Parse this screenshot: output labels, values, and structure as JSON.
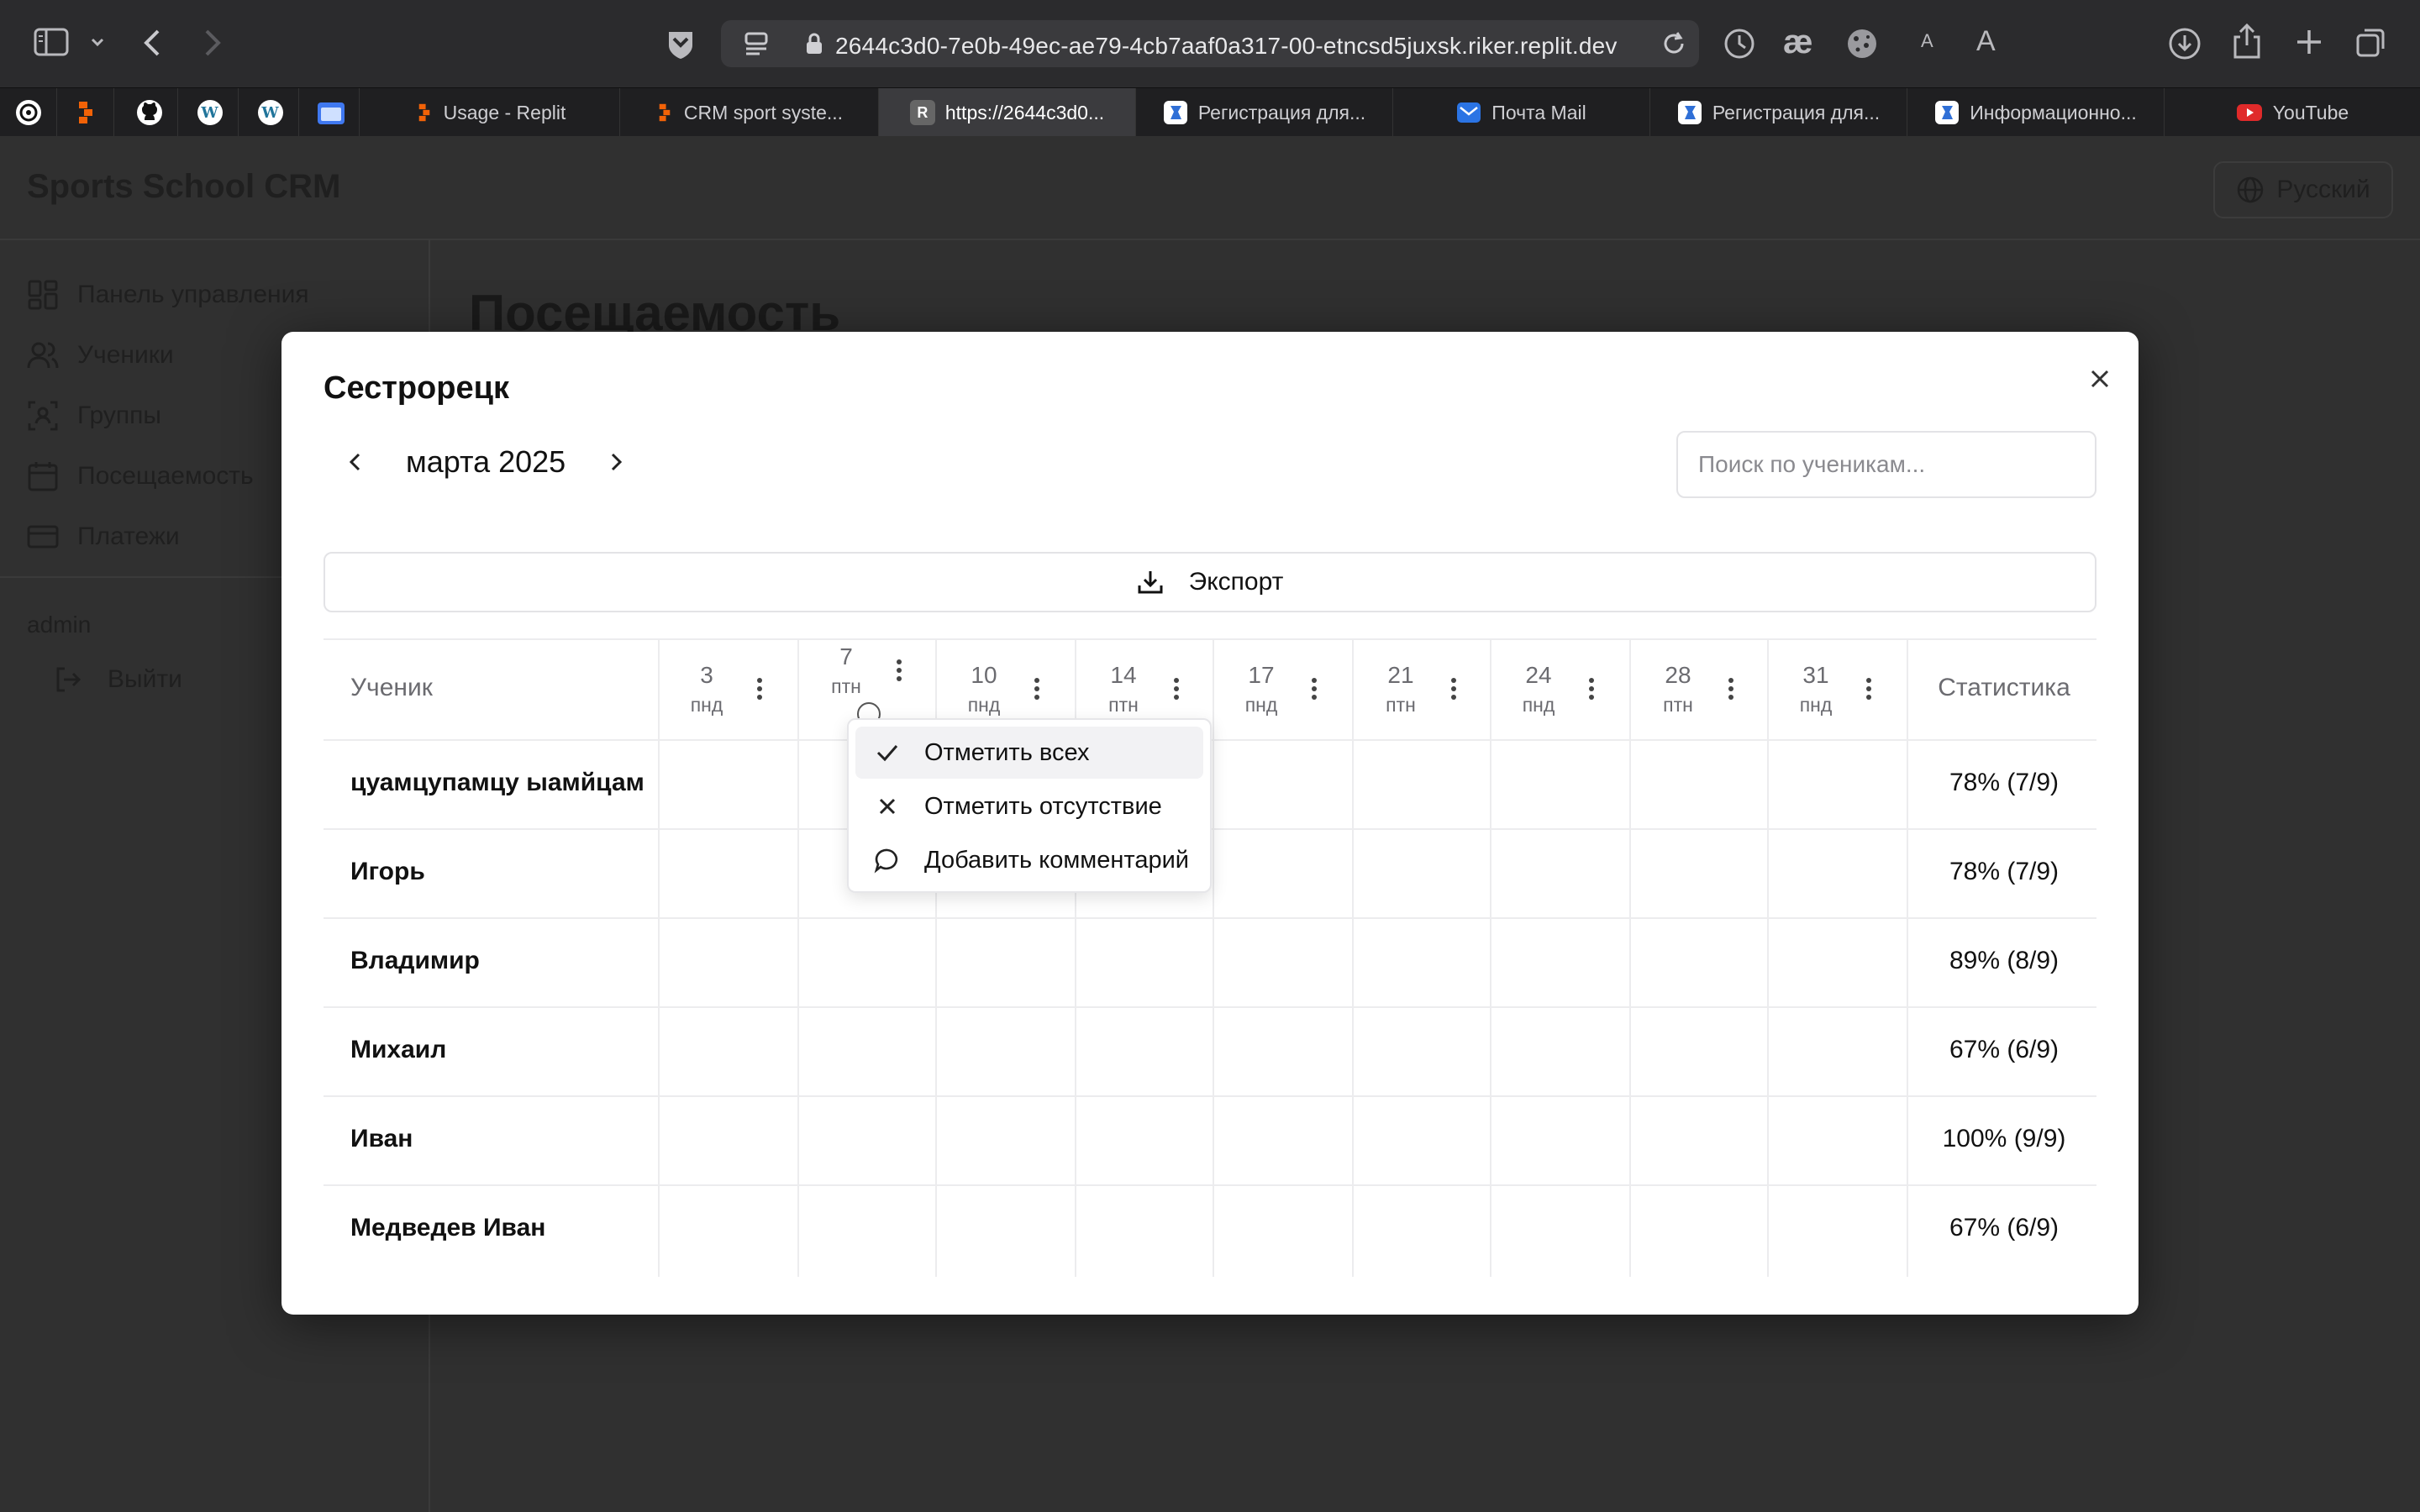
{
  "browser": {
    "url": "2644c3d0-7e0b-49ec-ae79-4cb7aaf0a317-00-etncsd5juxsk.riker.replit.dev",
    "reader_small": "A",
    "reader_large": "A",
    "tabs": [
      {
        "label": "Usage - Replit",
        "favicon": "replit"
      },
      {
        "label": "CRM sport syste...",
        "favicon": "replit"
      },
      {
        "label": "https://2644c3d0...",
        "favicon": "R",
        "active": true
      },
      {
        "label": "Регистрация для...",
        "favicon": "gosuslugi"
      },
      {
        "label": "Почта Mail",
        "favicon": "mail"
      },
      {
        "label": "Регистрация для...",
        "favicon": "gosuslugi"
      },
      {
        "label": "Информационно...",
        "favicon": "gosuslugi"
      },
      {
        "label": "YouTube",
        "favicon": "youtube"
      }
    ],
    "pinned_favicon_letters": {
      "r": "R",
      "wordpress": "W"
    }
  },
  "app": {
    "brand": "Sports School CRM",
    "language": "Русский",
    "page_title": "Посещаемость",
    "nav": [
      {
        "label": "Панель управления",
        "icon": "dashboard-icon"
      },
      {
        "label": "Ученики",
        "icon": "users-icon"
      },
      {
        "label": "Группы",
        "icon": "groups-icon"
      },
      {
        "label": "Посещаемость",
        "icon": "calendar-icon"
      },
      {
        "label": "Платежи",
        "icon": "credit-card-icon"
      }
    ],
    "user": "admin",
    "logout": "Выйти"
  },
  "modal": {
    "title": "Сестрорецк",
    "month": "марта 2025",
    "search_placeholder": "Поиск по ученикам...",
    "export_label": "Экспорт",
    "header_student": "Ученик",
    "header_stats": "Статистика",
    "days": [
      {
        "num": "3",
        "wd": "пнд"
      },
      {
        "num": "7",
        "wd": "птн"
      },
      {
        "num": "10",
        "wd": "пнд"
      },
      {
        "num": "14",
        "wd": "птн"
      },
      {
        "num": "17",
        "wd": "пнд"
      },
      {
        "num": "21",
        "wd": "птн"
      },
      {
        "num": "24",
        "wd": "пнд"
      },
      {
        "num": "28",
        "wd": "птн"
      },
      {
        "num": "31",
        "wd": "пнд"
      }
    ],
    "rows": [
      {
        "name": "цуамцупамцу ыамйцам",
        "stat": "78% (7/9)"
      },
      {
        "name": "Игорь",
        "stat": "78% (7/9)"
      },
      {
        "name": "Владимир",
        "stat": "89% (8/9)"
      },
      {
        "name": "Михаил",
        "stat": "67% (6/9)"
      },
      {
        "name": "Иван",
        "stat": "100% (9/9)"
      },
      {
        "name": "Медведев Иван",
        "stat": "67% (6/9)"
      }
    ],
    "dropdown": [
      {
        "label": "Отметить всех",
        "icon": "check-icon"
      },
      {
        "label": "Отметить отсутствие",
        "icon": "x-icon"
      },
      {
        "label": "Добавить комментарий",
        "icon": "comment-icon"
      }
    ]
  },
  "colors": {
    "accent_red": "#e02a2a",
    "replit_orange": "#f26207",
    "mail_blue": "#2b74e4"
  }
}
